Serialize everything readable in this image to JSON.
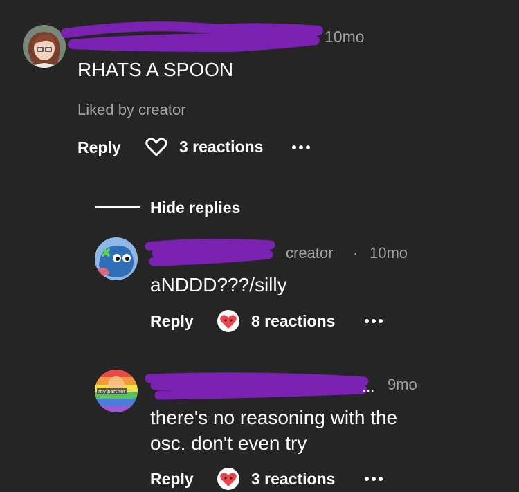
{
  "comment": {
    "time": "10mo",
    "text": "RHATS A SPOON",
    "liked_by": "Liked by creator",
    "reply_label": "Reply",
    "reactions": "3 reactions"
  },
  "hide_replies": "Hide replies",
  "replies": [
    {
      "badge": "creator",
      "separator": "·",
      "time": "10mo",
      "text": "aNDDD???/silly",
      "reply_label": "Reply",
      "reactions": "8 reactions"
    },
    {
      "name_suffix": "...",
      "time": "9mo",
      "text_line1": "there's no reasoning with the",
      "text_line2": "osc. don't even try",
      "reply_label": "Reply",
      "reactions": "3 reactions",
      "avatar_caption": "my partner"
    }
  ],
  "colors": {
    "background": "#252525",
    "redaction": "#7b22b3",
    "meta": "#a3a3a3",
    "reaction": "#e8474f"
  }
}
